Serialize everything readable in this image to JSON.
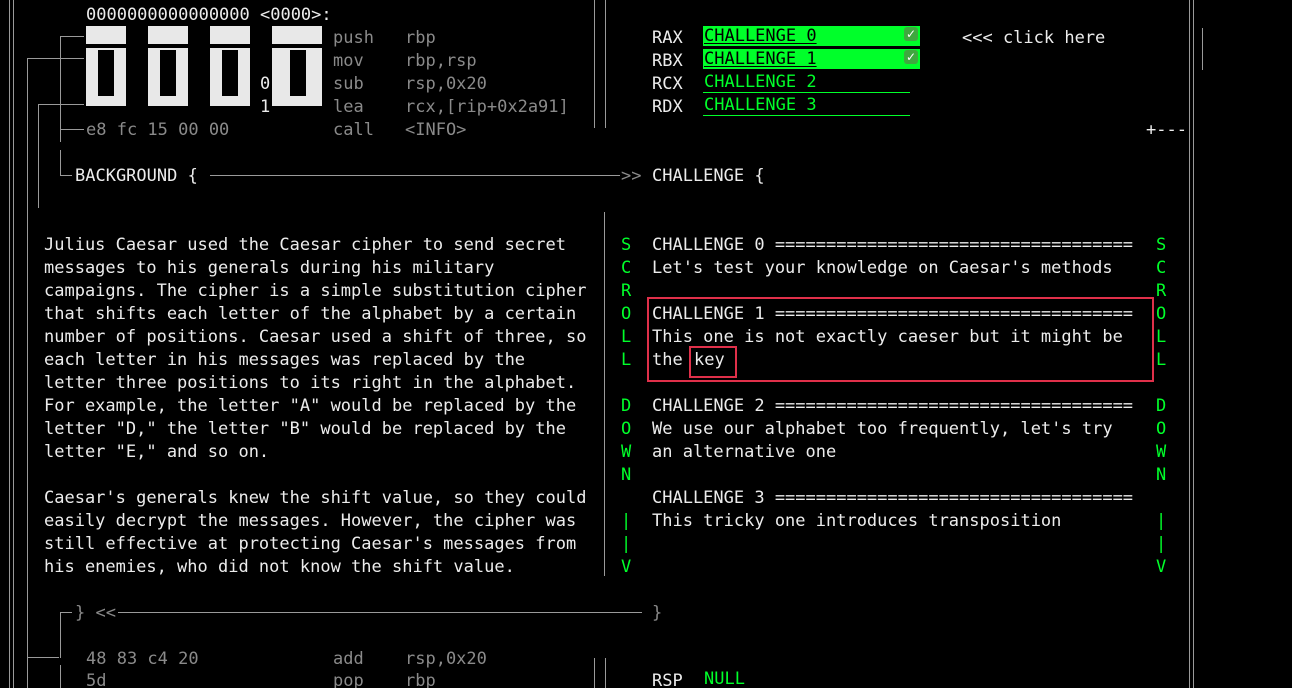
{
  "header": {
    "address": "0000000000000000 <0000>:"
  },
  "asm_top": [
    {
      "mnemonic": "push",
      "operands": "rbp"
    },
    {
      "mnemonic": "mov",
      "operands": "rbp,rsp"
    },
    {
      "mnemonic": "sub",
      "operands": "rsp,0x20"
    },
    {
      "mnemonic": "lea",
      "operands": "rcx,[rip+0x2a91]"
    },
    {
      "bytes": "e8 fc 15 00 00",
      "mnemonic": "call",
      "operands": "<INFO>"
    }
  ],
  "logo_digits": [
    "0",
    "1"
  ],
  "registers": [
    {
      "name": "RAX",
      "label": "CHALLENGE 0",
      "completed": true
    },
    {
      "name": "RBX",
      "label": "CHALLENGE 1",
      "completed": true
    },
    {
      "name": "RCX",
      "label": "CHALLENGE 2",
      "completed": false
    },
    {
      "name": "RDX",
      "label": "CHALLENGE 3",
      "completed": false
    }
  ],
  "click_hint": "<<< click here",
  "corner_mark": "+---",
  "background_section": {
    "heading": "BACKGROUND {",
    "arrow": ">>",
    "close": "} <<",
    "paragraphs": [
      [
        "Julius Caesar used the Caesar cipher to send secret",
        "messages to his generals during his military",
        "campaigns. The cipher is a simple substitution cipher",
        "that shifts each letter of the alphabet by a certain",
        "number of positions. Caesar used a shift of three, so",
        "each letter in his messages was replaced by the",
        "letter three positions to its right in the alphabet.",
        "For example, the letter \"A\" would be replaced by the",
        "letter \"D,\" the letter \"B\" would be replaced by the",
        "letter \"E,\" and so on."
      ],
      [
        "Caesar's generals knew the shift value, so they could",
        "easily decrypt the messages. However, the cipher was",
        "still effective at protecting Caesar's messages from",
        "his enemies, who did not know the shift value."
      ]
    ]
  },
  "scroll_indicator": [
    "S",
    "C",
    "R",
    "O",
    "L",
    "L",
    "",
    "D",
    "O",
    "W",
    "N",
    "",
    "|",
    "|",
    "V"
  ],
  "challenge_section": {
    "heading": "CHALLENGE {",
    "close": "}",
    "challenges": [
      {
        "title": "CHALLENGE 0 ===================================",
        "lines": [
          "Let's test your knowledge on Caesar's methods"
        ]
      },
      {
        "title": "CHALLENGE 1 ===================================",
        "lines": [
          "This one is not exactly caeser but it might be",
          "the"
        ],
        "highlight_word": "key"
      },
      {
        "title": "CHALLENGE 2 ===================================",
        "lines": [
          "We use our alphabet too frequently, let's try",
          "an alternative one"
        ]
      },
      {
        "title": "CHALLENGE 3 ===================================",
        "lines": [
          "This tricky one introduces transposition"
        ]
      }
    ]
  },
  "asm_bottom": [
    {
      "bytes": "48 83 c4 20",
      "mnemonic": "add",
      "operands": "rsp,0x20"
    },
    {
      "bytes": "5d",
      "mnemonic": "pop",
      "operands": "rbp"
    }
  ],
  "rsp": {
    "name": "RSP",
    "value": "NULL"
  },
  "colors": {
    "accent_green": "#00ff2a",
    "highlight_red": "#e0304a",
    "background": "#000000",
    "dim_gray": "#8a8a8a"
  }
}
